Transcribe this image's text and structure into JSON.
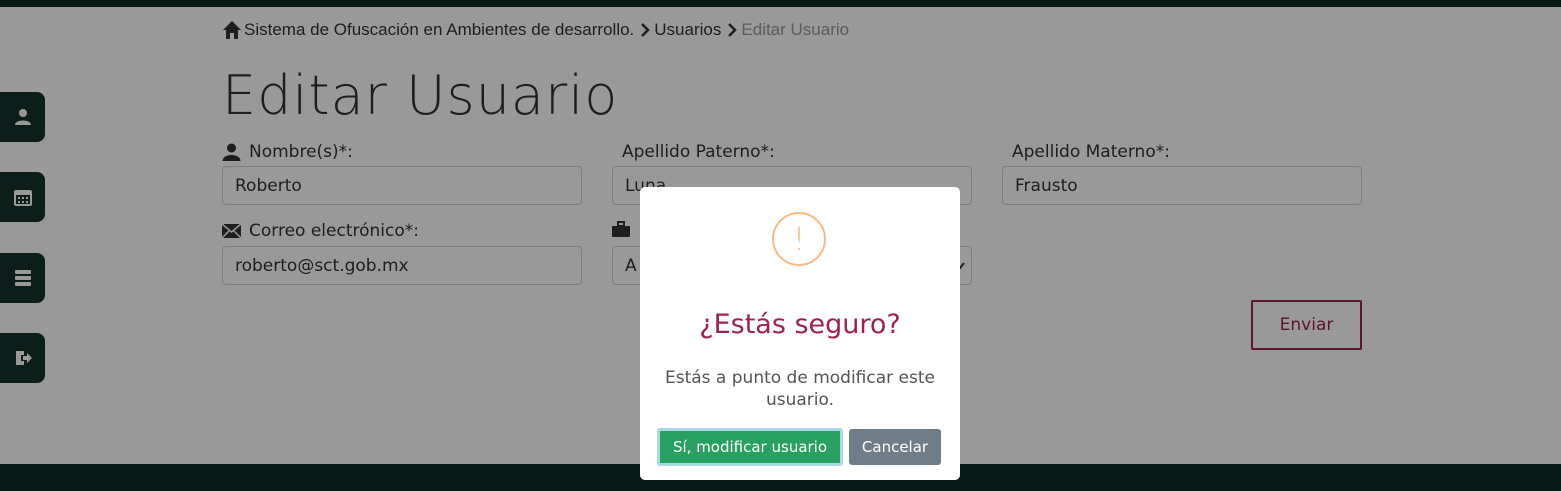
{
  "breadcrumb": {
    "items": [
      "Sistema de Ofuscación en Ambientes de desarrollo.",
      "Usuarios",
      "Editar Usuario"
    ]
  },
  "page": {
    "title": "Editar Usuario"
  },
  "sidebar": {
    "items": [
      {
        "icon": "user-icon"
      },
      {
        "icon": "calendar-icon"
      },
      {
        "icon": "server-icon"
      },
      {
        "icon": "logout-icon"
      }
    ]
  },
  "form": {
    "nombre_label": "Nombre(s)*:",
    "nombre_value": "Roberto",
    "paterno_label": "Apellido Paterno*:",
    "paterno_value": "Luna",
    "materno_label": "Apellido Materno*:",
    "materno_value": "Frausto",
    "correo_label": "Correo electrónico*:",
    "correo_value": "roberto@sct.gob.mx",
    "area_value": "A",
    "submit_label": "Enviar"
  },
  "modal": {
    "icon": "warning-icon",
    "icon_glyph": "!",
    "title": "¿Estás seguro?",
    "text": "Estás a punto de modificar este usuario.",
    "confirm_label": "Sí, modificar usuario",
    "cancel_label": "Cancelar"
  },
  "colors": {
    "brand_dark": "#13322b",
    "accent": "#9d2449",
    "confirm": "#28a160",
    "cancel": "#6e7d88",
    "warning": "#f8bb86"
  }
}
